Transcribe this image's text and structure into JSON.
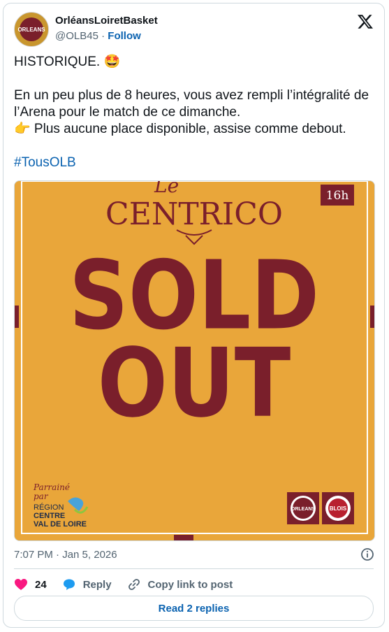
{
  "author": {
    "display_name": "OrléansLoiretBasket",
    "handle": "@OLB45",
    "separator": "·",
    "follow_label": "Follow",
    "avatar_text": "ORLEANS"
  },
  "tweet": {
    "line1": "HISTORIQUE. 🤩",
    "line2": "En un peu plus de 8 heures, vous avez rempli l’intégralité de l’Arena pour le match de ce dimanche.",
    "line3": "👉 Plus aucune place disponible, assise comme debout.",
    "hashtag": "#TousOLB"
  },
  "media": {
    "title_top": "Le",
    "title": "CENTRICO",
    "time_badge": "16h",
    "headline_1": "SOLD",
    "headline_2": "OUT",
    "sponsor_line1": "Parrainé",
    "sponsor_line2": "par",
    "region_1": "RÉGION",
    "region_2": "CENTRE",
    "region_3": "VAL DE LOIRE",
    "logo_left": "ORLEANS",
    "logo_right": "BLOIS",
    "colors": {
      "background": "#e9a63a",
      "maroon": "#7a1f2b"
    }
  },
  "meta": {
    "timestamp": "7:07 PM · Jan 5, 2026"
  },
  "actions": {
    "like_count": "24",
    "reply_label": "Reply",
    "copy_label": "Copy link to post"
  },
  "read_replies_label": "Read 2 replies",
  "colors": {
    "link": "#0a62b0",
    "like": "#f91880",
    "muted": "#536471"
  }
}
